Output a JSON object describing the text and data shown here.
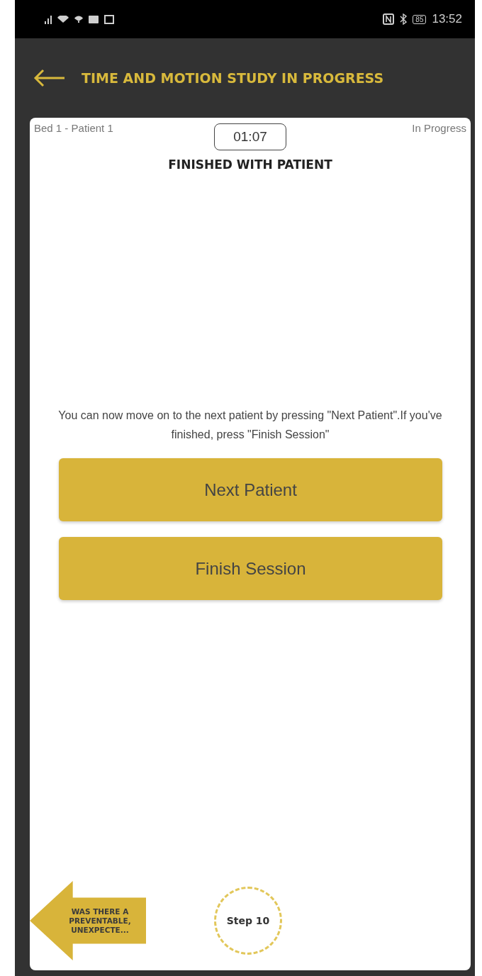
{
  "status_bar": {
    "battery": "85",
    "time": "13:52"
  },
  "header": {
    "title": "TIME AND MOTION STUDY IN PROGRESS"
  },
  "card": {
    "location": "Bed 1 - Patient 1",
    "timer": "01:07",
    "status": "In Progress",
    "heading": "FINISHED WITH PATIENT",
    "instructions": "You can now move on to the next patient by pressing \"Next Patient\".If you've finished, press \"Finish Session\"",
    "buttons": [
      "Next Patient",
      "Finish Session"
    ],
    "previous_step": "WAS THERE A PREVENTABLE, UNEXPECTE...",
    "step": "Step 10"
  }
}
